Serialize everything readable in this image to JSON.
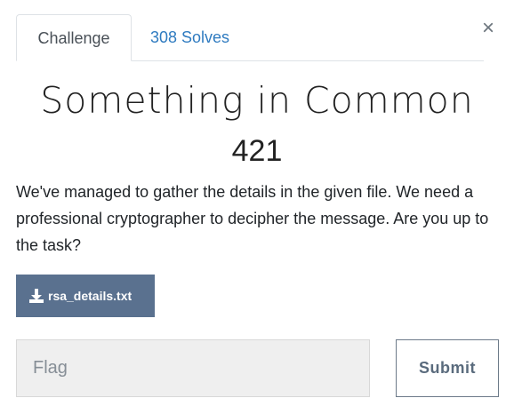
{
  "tabs": [
    {
      "label": "Challenge",
      "active": true
    },
    {
      "label": "308 Solves",
      "active": false
    }
  ],
  "close_label": "×",
  "challenge": {
    "title": "Something in Common",
    "value": "421",
    "description": "We've managed to gather the details in the given file. We need a professional cryptographer to decipher the message. Are you up to the task?"
  },
  "file": {
    "icon": "download-icon",
    "name": "rsa_details.txt"
  },
  "flag_form": {
    "placeholder": "Flag",
    "value": "",
    "submit_label": "Submit"
  },
  "colors": {
    "accent_link": "#2f7bc0",
    "file_button_bg": "#5a718f",
    "input_bg": "#efefef"
  }
}
